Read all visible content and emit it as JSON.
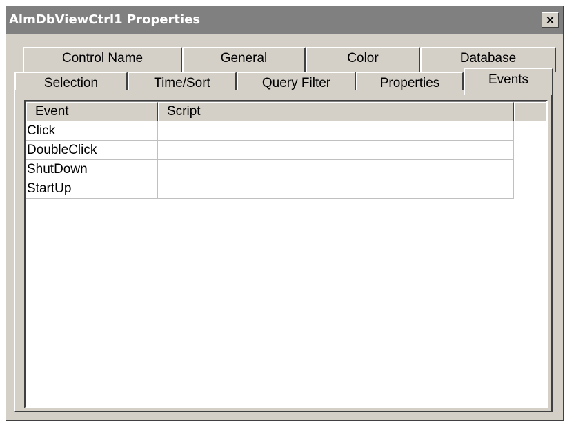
{
  "window": {
    "title": "AlmDbViewCtrl1 Properties"
  },
  "tabs": {
    "row_back": [
      {
        "label": "Control Name"
      },
      {
        "label": "General"
      },
      {
        "label": "Color"
      },
      {
        "label": "Database"
      }
    ],
    "row_front": [
      {
        "label": "Selection"
      },
      {
        "label": "Time/Sort"
      },
      {
        "label": "Query Filter"
      },
      {
        "label": "Properties"
      },
      {
        "label": "Events"
      }
    ],
    "active": "Events"
  },
  "grid": {
    "columns": [
      "Event",
      "Script"
    ],
    "rows": [
      {
        "event": "Click",
        "script": ""
      },
      {
        "event": "DoubleClick",
        "script": ""
      },
      {
        "event": "ShutDown",
        "script": ""
      },
      {
        "event": "StartUp",
        "script": ""
      }
    ]
  }
}
